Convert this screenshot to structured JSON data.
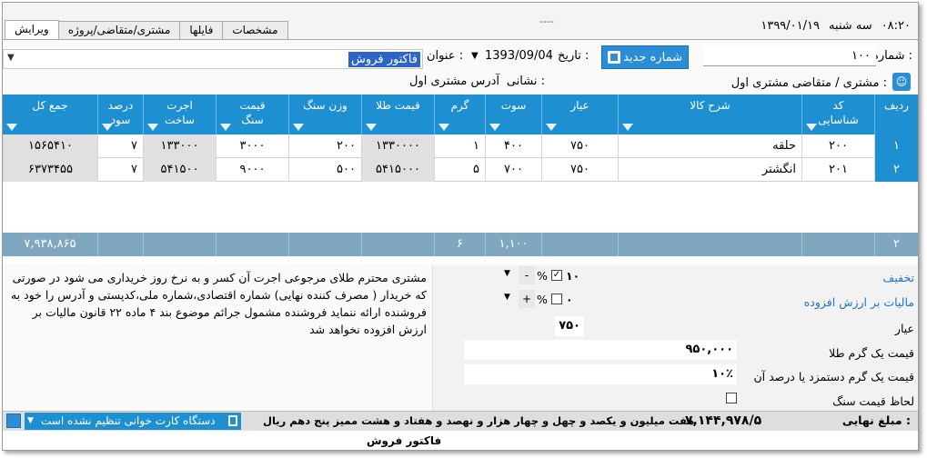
{
  "datetime": {
    "time": "۰۸:۲۰",
    "day": "سه شنبه",
    "date": "۱۳۹۹/۰۱/۱۹"
  },
  "tabs": [
    {
      "label": "ویرایش",
      "active": true
    },
    {
      "label": "مشتری/متقاضی/پروژه",
      "active": false
    },
    {
      "label": "فایلها",
      "active": false
    },
    {
      "label": "مشخصات",
      "active": false
    }
  ],
  "header": {
    "number_label": "شماره :",
    "number_value": "۱۰۰",
    "new_number_button": "شماره جدید",
    "date_label": "تاریخ :",
    "date_value": "1393/09/04",
    "title_label": "عنوان :",
    "title_value": "فاکتور فروش",
    "customer_label": "مشتری / متقاضی :",
    "customer_value": "مشتری اول",
    "address_label": "نشانی :",
    "address_value": "آدرس مشتری اول"
  },
  "grid": {
    "columns": [
      {
        "key": "row",
        "label": "ردیف"
      },
      {
        "key": "code",
        "label": "کد شناسایی"
      },
      {
        "key": "desc",
        "label": "شرح کالا"
      },
      {
        "key": "karat",
        "label": "عیار"
      },
      {
        "key": "sut",
        "label": "سوت"
      },
      {
        "key": "gram",
        "label": "گرم"
      },
      {
        "key": "gold_price",
        "label": "قیمت طلا"
      },
      {
        "key": "stone_weight",
        "label": "وزن سنگ"
      },
      {
        "key": "stone_price",
        "label": "قیمت سنگ"
      },
      {
        "key": "wage",
        "label": "اجرت ساخت"
      },
      {
        "key": "profit",
        "label": "درصد سود"
      },
      {
        "key": "total",
        "label": "جمع کل"
      }
    ],
    "rows": [
      {
        "row": "۱",
        "code": "۲۰۰",
        "desc": "حلقه",
        "karat": "۷۵۰",
        "sut": "۴۰۰",
        "gram": "۱",
        "gold_price": "۱۳۳۰۰۰۰",
        "stone_weight": "۲۰۰",
        "stone_price": "۳۰۰۰",
        "wage": "۱۳۳۰۰۰",
        "profit": "۷",
        "total": "۱۵۶۵۴۱۰"
      },
      {
        "row": "۲",
        "code": "۲۰۱",
        "desc": "انگشتر",
        "karat": "۷۵۰",
        "sut": "۷۰۰",
        "gram": "۵",
        "gold_price": "۵۴۱۵۰۰۰",
        "stone_weight": "۵۰۰",
        "stone_price": "۹۰۰۰",
        "wage": "۵۴۱۵۰۰",
        "profit": "۷",
        "total": "۶۳۷۳۴۵۵"
      }
    ],
    "footer": {
      "row_count": "۲",
      "sut_total": "۱,۱۰۰",
      "gram_total": "۶",
      "grand_total": "۷,۹۳۸,۸۶۵"
    }
  },
  "note": "مشتری محترم طلای مرجوعی اجرت آن کسر و به نرخ روز خریداری می شود در صورتی که خریدار ( مصرف کننده نهایی) شماره اقتصادی،شماره ملی،کدپستی و آدرس را خود به فروشنده ارائه ننماید فروشنده مشمول جرائم موضوع بند ۴ ماده ۲۲ قانون مالیات بر ارزش افزوده نخواهد شد",
  "panel": {
    "discount_label": "تخفیف",
    "discount_value": "۱۰",
    "discount_checked": true,
    "vat_label": "مالیات بر ارزش افزوده",
    "vat_value": "۰",
    "vat_checked": false,
    "percent_sign": "%",
    "minus": "-",
    "plus": "+",
    "karat_label": "عیار",
    "karat_value": "۷۵۰",
    "gram_price_label": "قیمت یک گرم طلا",
    "gram_price_value": "۹۵۰,۰۰۰",
    "wage_label": "قیمت یک گرم دستمزد یا درصد آن",
    "wage_value": "۱۰٪",
    "stone_label": "لحاظ قیمت سنگ"
  },
  "totals": {
    "final_label": "مبلغ نهایی :",
    "final_value": "۷,۱۴۴,۹۷۸/۵",
    "words": "هفت میلیون و یکصد و چهل و چهار هزار و نهصد و هفتاد و هشت ممیز پنج دهم ریال",
    "card_reader": "دستگاه کارت خوانی تنظیم نشده است"
  },
  "bottom_strip": "فاکتور فروش"
}
